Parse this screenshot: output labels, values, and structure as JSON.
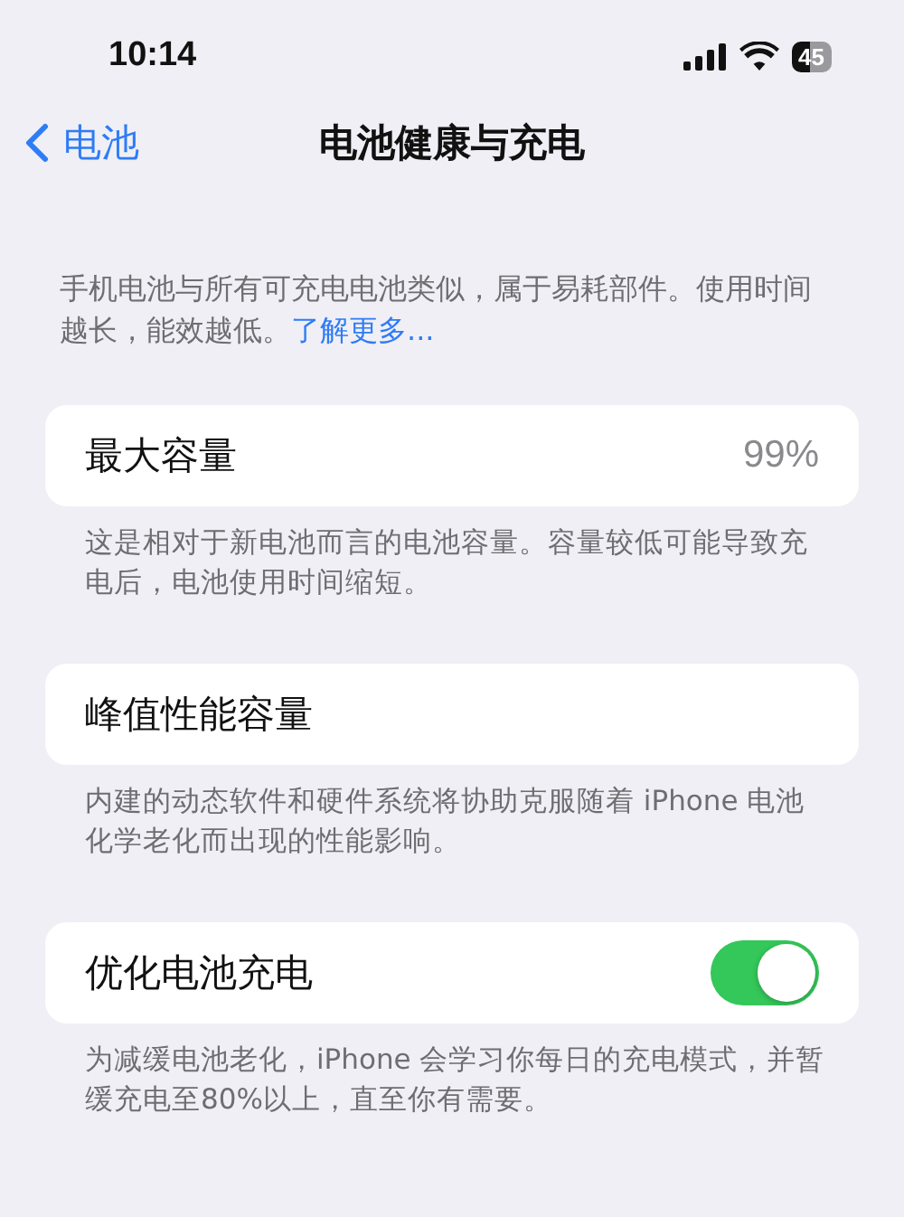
{
  "status_bar": {
    "time": "10:14",
    "battery": "45"
  },
  "nav": {
    "back": "电池",
    "title": "电池健康与充电"
  },
  "intro": {
    "text": "手机电池与所有可充电电池类似，属于易耗部件。使用时间越长，能效越低。",
    "link": "了解更多..."
  },
  "rows": [
    {
      "kind": "value",
      "label": "最大容量",
      "value": "99%",
      "footer": "这是相对于新电池而言的电池容量。容量较低可能导致充电后，电池使用时间缩短。"
    },
    {
      "kind": "plain",
      "label": "峰值性能容量",
      "footer": "内建的动态软件和硬件系统将协助克服随着 iPhone 电池化学老化而出现的性能影响。"
    },
    {
      "kind": "toggle",
      "label": "优化电池充电",
      "on": true,
      "footer": "为减缓电池老化，iPhone 会学习你每日的充电模式，并暂缓充电至80%以上，直至你有需要。"
    }
  ]
}
